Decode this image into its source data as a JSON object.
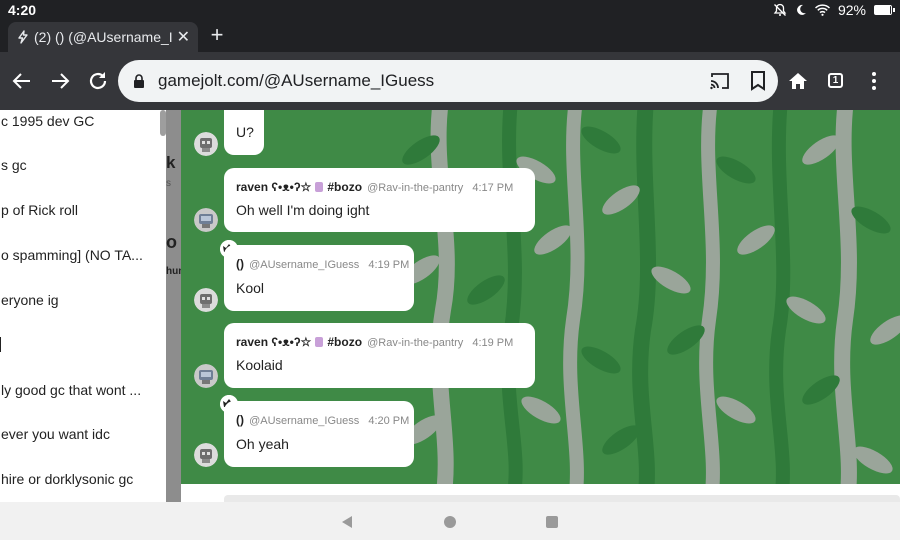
{
  "status_bar": {
    "time": "4:20",
    "battery": "92%",
    "battery_level": 0.92
  },
  "tab": {
    "title": "(2) () (@AUsername_IG"
  },
  "omnibox": {
    "url": "gamejolt.com/@AUsername_IGuess"
  },
  "toolbar": {
    "tab_count": "1"
  },
  "sidebar": {
    "items": [
      "c 1995 dev GC",
      "s gc",
      "p of Rick roll",
      "o spamming] (NO TA...",
      "eryone ig",
      "",
      "ly good gc that wont ...",
      "ever you want idc",
      "hire or dorklysonic gc"
    ],
    "edge_glyphs": [
      "k",
      "s",
      "o",
      "hun"
    ]
  },
  "messages": [
    {
      "name": "",
      "tag": "",
      "handle": "",
      "time": "",
      "text": "U?"
    },
    {
      "name": "raven ʕ•ᴥ•ʔ☆",
      "tag": "#bozo",
      "handle": "@Rav-in-the-pantry",
      "time": "4:17 PM",
      "text": "Oh well I'm doing ight"
    },
    {
      "name": "()",
      "tag": "",
      "handle": "@AUsername_IGuess",
      "time": "4:19 PM",
      "text": "Kool"
    },
    {
      "name": "raven ʕ•ᴥ•ʔ☆",
      "tag": "#bozo",
      "handle": "@Rav-in-the-pantry",
      "time": "4:19 PM",
      "text": "Koolaid"
    },
    {
      "name": "()",
      "tag": "",
      "handle": "@AUsername_IGuess",
      "time": "4:20 PM",
      "text": "Oh yeah"
    }
  ],
  "colors": {
    "chat_background": "#3f8a46",
    "leaf_green": "#2f7a3a",
    "leaf_grey": "#9aa59a",
    "browser_dark": "#35363a"
  },
  "icons": {
    "back": "back-arrow-icon",
    "forward": "forward-arrow-icon",
    "reload": "reload-icon",
    "lock": "lock-icon",
    "cast": "cast-icon",
    "bookmark": "bookmark-icon",
    "home": "home-icon",
    "menu": "more-vertical-icon",
    "crown": "crown-icon"
  }
}
